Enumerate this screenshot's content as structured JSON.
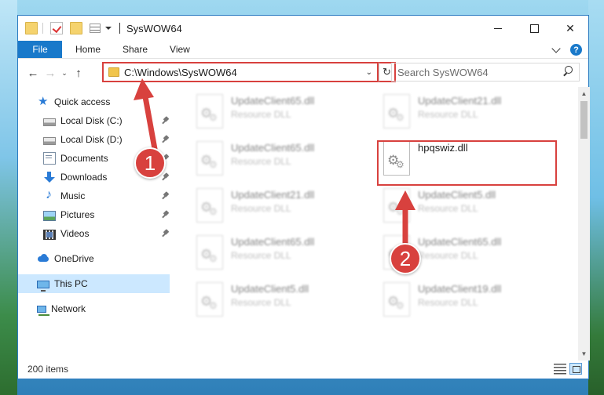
{
  "window": {
    "title": "SysWOW64",
    "controls": {
      "minimize": "",
      "maximize": "",
      "close": "✕"
    }
  },
  "ribbon": {
    "tabs": [
      "File",
      "Home",
      "Share",
      "View"
    ],
    "help": "?"
  },
  "nav": {
    "back": "←",
    "forward": "→",
    "recent": "⌄",
    "up": "↑",
    "address": "C:\\Windows\\SysWOW64",
    "address_dropdown": "⌄",
    "refresh": "↻",
    "search_placeholder": "Search SysWOW64"
  },
  "sidebar": {
    "items": [
      {
        "label": "Quick access",
        "icon": "star-icon",
        "pinned": false
      },
      {
        "label": "Local Disk (C:)",
        "icon": "disk-icon",
        "pinned": true
      },
      {
        "label": "Local Disk (D:)",
        "icon": "disk-icon",
        "pinned": true
      },
      {
        "label": "Documents",
        "icon": "documents-icon",
        "pinned": true
      },
      {
        "label": "Downloads",
        "icon": "download-icon",
        "pinned": true
      },
      {
        "label": "Music",
        "icon": "music-icon",
        "pinned": true
      },
      {
        "label": "Pictures",
        "icon": "pictures-icon",
        "pinned": true
      },
      {
        "label": "Videos",
        "icon": "videos-icon",
        "pinned": true
      },
      {
        "label": "OneDrive",
        "icon": "cloud-icon",
        "pinned": false
      },
      {
        "label": "This PC",
        "icon": "computer-icon",
        "pinned": false,
        "selected": true
      },
      {
        "label": "Network",
        "icon": "network-icon",
        "pinned": false
      }
    ]
  },
  "files": [
    {
      "name": "UpdateClient65.dll",
      "type": "Resource DLL",
      "blurred": true
    },
    {
      "name": "UpdateClient21.dll",
      "type": "Resource DLL",
      "blurred": true
    },
    {
      "name": "UpdateClient65.dll",
      "type": "Resource DLL",
      "blurred": true
    },
    {
      "name": "hpqswiz.dll",
      "type": "",
      "blurred": false,
      "highlighted": true
    },
    {
      "name": "UpdateClient21.dll",
      "type": "Resource DLL",
      "blurred": true
    },
    {
      "name": "UpdateClient5.dll",
      "type": "Resource DLL",
      "blurred": true
    },
    {
      "name": "UpdateClient65.dll",
      "type": "Resource DLL",
      "blurred": true
    },
    {
      "name": "UpdateClient65.dll",
      "type": "Resource DLL",
      "blurred": true
    },
    {
      "name": "UpdateClient5.dll",
      "type": "Resource DLL",
      "blurred": true
    },
    {
      "name": "UpdateClient19.dll",
      "type": "Resource DLL",
      "blurred": true
    }
  ],
  "status": {
    "item_count": "200 items"
  },
  "annotations": {
    "marker1": "1",
    "marker2": "2",
    "color": "#d8413e"
  }
}
